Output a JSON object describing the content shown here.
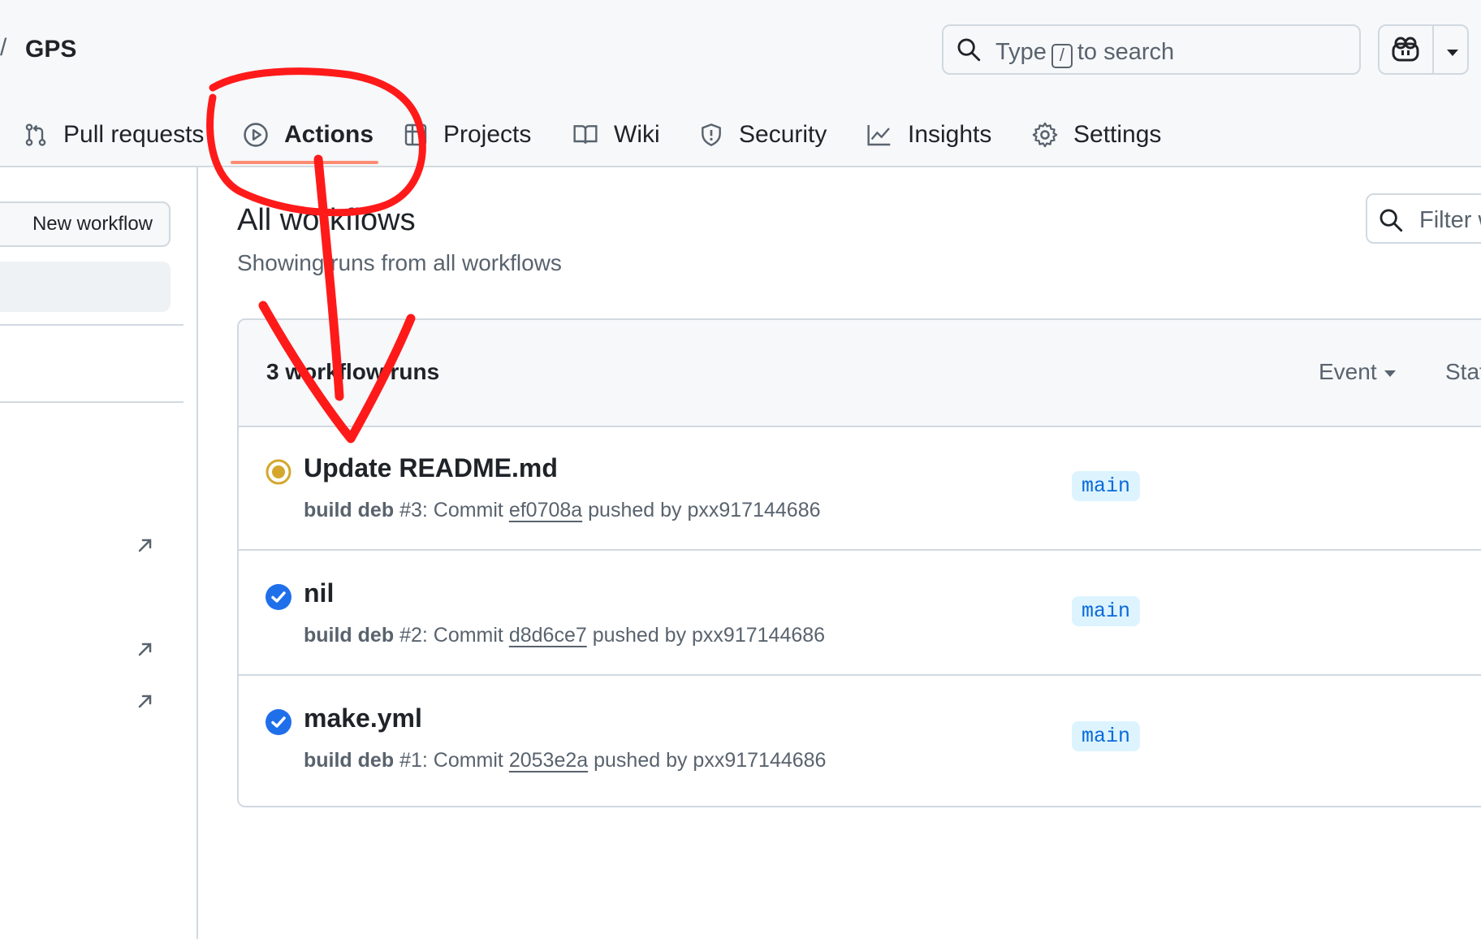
{
  "repo": {
    "separator": "/",
    "name": "GPS"
  },
  "search": {
    "prefix": "Type",
    "key": "/",
    "suffix": "to search"
  },
  "nav": {
    "tabs": [
      {
        "label": "Pull requests",
        "icon": "git-pull-request-icon"
      },
      {
        "label": "Actions",
        "icon": "play-icon",
        "active": true
      },
      {
        "label": "Projects",
        "icon": "table-icon"
      },
      {
        "label": "Wiki",
        "icon": "book-icon"
      },
      {
        "label": "Security",
        "icon": "shield-icon"
      },
      {
        "label": "Insights",
        "icon": "graph-icon"
      },
      {
        "label": "Settings",
        "icon": "gear-icon"
      }
    ]
  },
  "sidebar": {
    "new_workflow_label": "New workflow"
  },
  "main": {
    "title": "All workflows",
    "subtitle": "Showing runs from all workflows",
    "filter_placeholder": "Filter w"
  },
  "runs": {
    "count_label": "3 workflow runs",
    "event_label": "Event",
    "status_label": "Status",
    "items": [
      {
        "title": "Update README.md",
        "workflow": "build deb",
        "number_text": "#3: Commit",
        "sha": "ef0708a",
        "pushed_by": "pushed by pxx917144686",
        "branch": "main",
        "status": "in-progress"
      },
      {
        "title": "nil",
        "workflow": "build deb",
        "number_text": "#2: Commit",
        "sha": "d8d6ce7",
        "pushed_by": "pushed by pxx917144686",
        "branch": "main",
        "status": "success"
      },
      {
        "title": "make.yml",
        "workflow": "build deb",
        "number_text": "#1: Commit",
        "sha": "2053e2a",
        "pushed_by": "pushed by pxx917144686",
        "branch": "main",
        "status": "success"
      }
    ]
  },
  "colors": {
    "accent": "#fd8c73",
    "annotation": "#ff0000",
    "success": "#1f6feb",
    "pending": "#d4a72c"
  }
}
